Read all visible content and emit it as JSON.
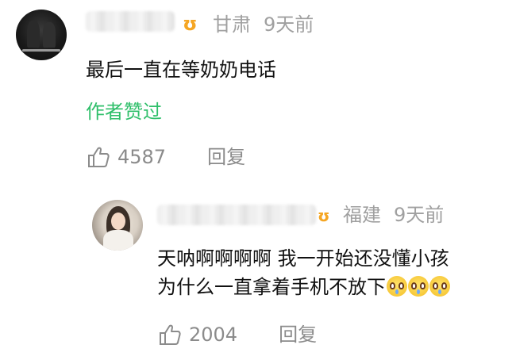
{
  "comments": [
    {
      "username": "",
      "location": "甘肃",
      "time": "9天前",
      "text": "最后一直在等奶奶电话",
      "author_liked": "作者赞过",
      "likes": "4587",
      "reply_label": "回复"
    }
  ],
  "reply": {
    "username": "",
    "location": "福建",
    "time": "9天前",
    "text_line1": "天呐啊啊啊啊 我一开始还没懂小孩",
    "text_line2": "为什么一直拿着手机不放下",
    "emoji_name": "crying-face",
    "emoji_count": 3,
    "likes": "2004",
    "reply_label": "回复"
  },
  "colors": {
    "author_liked": "#2fbf6a",
    "vip_badge": "#f5a623",
    "meta_gray": "#a0a0a0",
    "text": "#111111"
  },
  "icons": {
    "vip": "vip-badge-icon",
    "like": "thumbs-up-icon"
  }
}
